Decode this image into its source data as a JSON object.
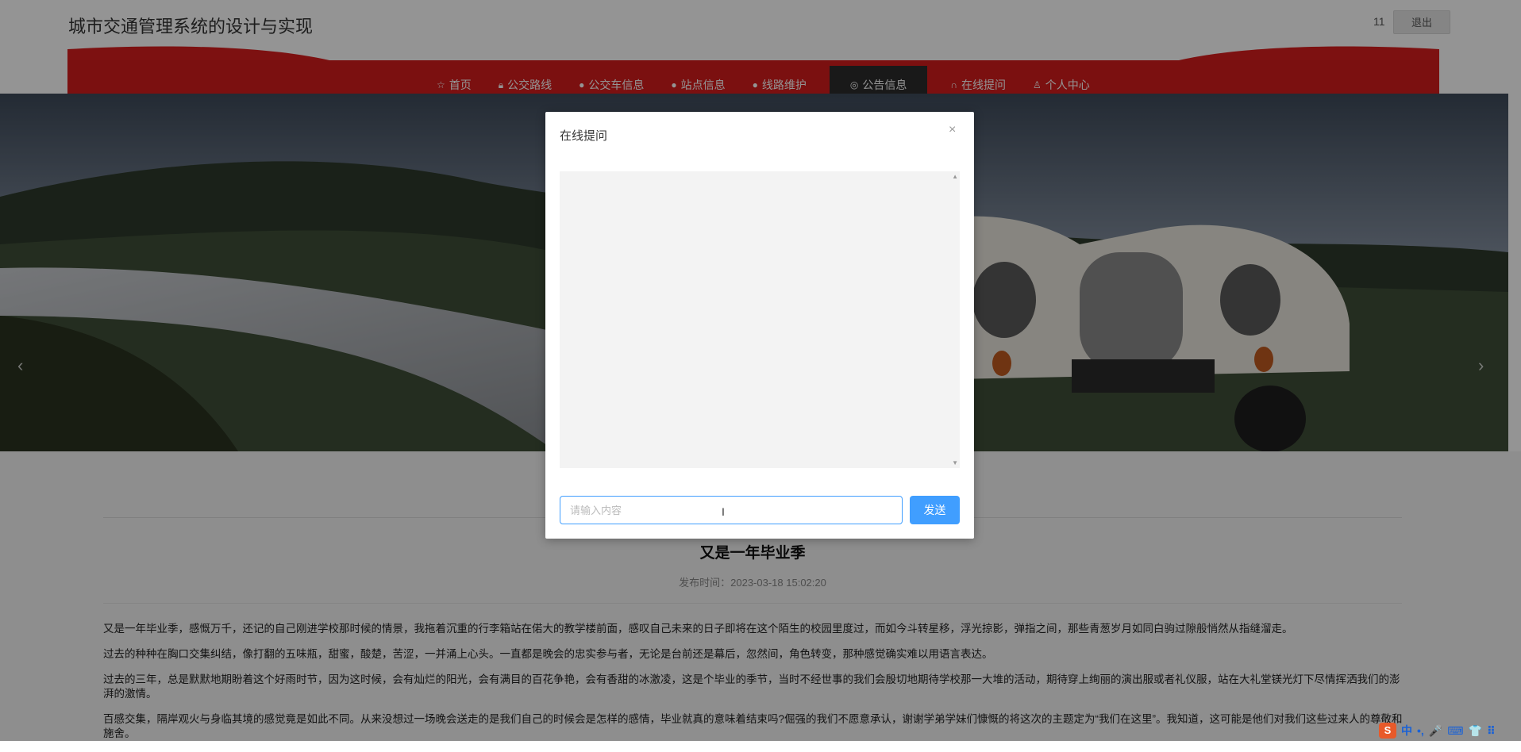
{
  "header": {
    "title": "城市交通管理系统的设计与实现",
    "username": "11",
    "logout_label": "退出"
  },
  "nav": {
    "items": [
      {
        "label": "首页",
        "icon": "star-icon"
      },
      {
        "label": "公交路线",
        "icon": "lock-icon"
      },
      {
        "label": "公交车信息",
        "icon": "info-circle-icon"
      },
      {
        "label": "站点信息",
        "icon": "question-circle-icon"
      },
      {
        "label": "线路维护",
        "icon": "question-circle-icon"
      },
      {
        "label": "公告信息",
        "icon": "globe-icon",
        "active": true
      },
      {
        "label": "在线提问",
        "icon": "headset-icon"
      },
      {
        "label": "个人中心",
        "icon": "user-icon"
      }
    ],
    "accent_color": "#d81e1e",
    "active_color": "#2b2b2b"
  },
  "banner": {
    "prev_label": "‹",
    "next_label": "›"
  },
  "article": {
    "title": "又是一年毕业季",
    "date": "发布时间：2023-03-18 15:02:20",
    "paragraphs": [
      "又是一年毕业季，感慨万千，还记的自己刚进学校那时候的情景，我拖着沉重的行李箱站在偌大的教学楼前面，感叹自己未来的日子即将在这个陌生的校园里度过，而如今斗转星移，浮光掠影，弹指之间，那些青葱岁月如同白驹过隙般悄然从指缝溜走。",
      "过去的种种在胸口交集纠结，像打翻的五味瓶，甜蜜，酸楚，苦涩，一并涌上心头。一直都是晚会的忠实参与者，无论是台前还是幕后，忽然间，角色转变，那种感觉确实难以用语言表达。",
      "过去的三年，总是默默地期盼着这个好雨时节，因为这时候，会有灿烂的阳光，会有满目的百花争艳，会有香甜的冰激凌，这是个毕业的季节，当时不经世事的我们会殷切地期待学校那一大堆的活动，期待穿上绚丽的演出服或者礼仪服，站在大礼堂镁光灯下尽情挥洒我们的澎湃的激情。",
      "百感交集，隔岸观火与身临其境的感觉竟是如此不同。从来没想过一场晚会送走的是我们自己的时候会是怎样的感情，毕业就真的意味着结束吗?倔强的我们不愿意承认，谢谢学弟学妹们慷慨的将这次的主题定为“我们在这里”。我知道，这可能是他们对我们这些过来人的尊敬和施舍。"
    ]
  },
  "modal": {
    "title": "在线提问",
    "close_label": "×",
    "input_placeholder": "请输入内容",
    "input_value": "",
    "send_label": "发送"
  },
  "ime": {
    "logo": "S",
    "items": [
      "中",
      "•,",
      "🎤",
      "⌨",
      "👕",
      "⠿"
    ]
  }
}
